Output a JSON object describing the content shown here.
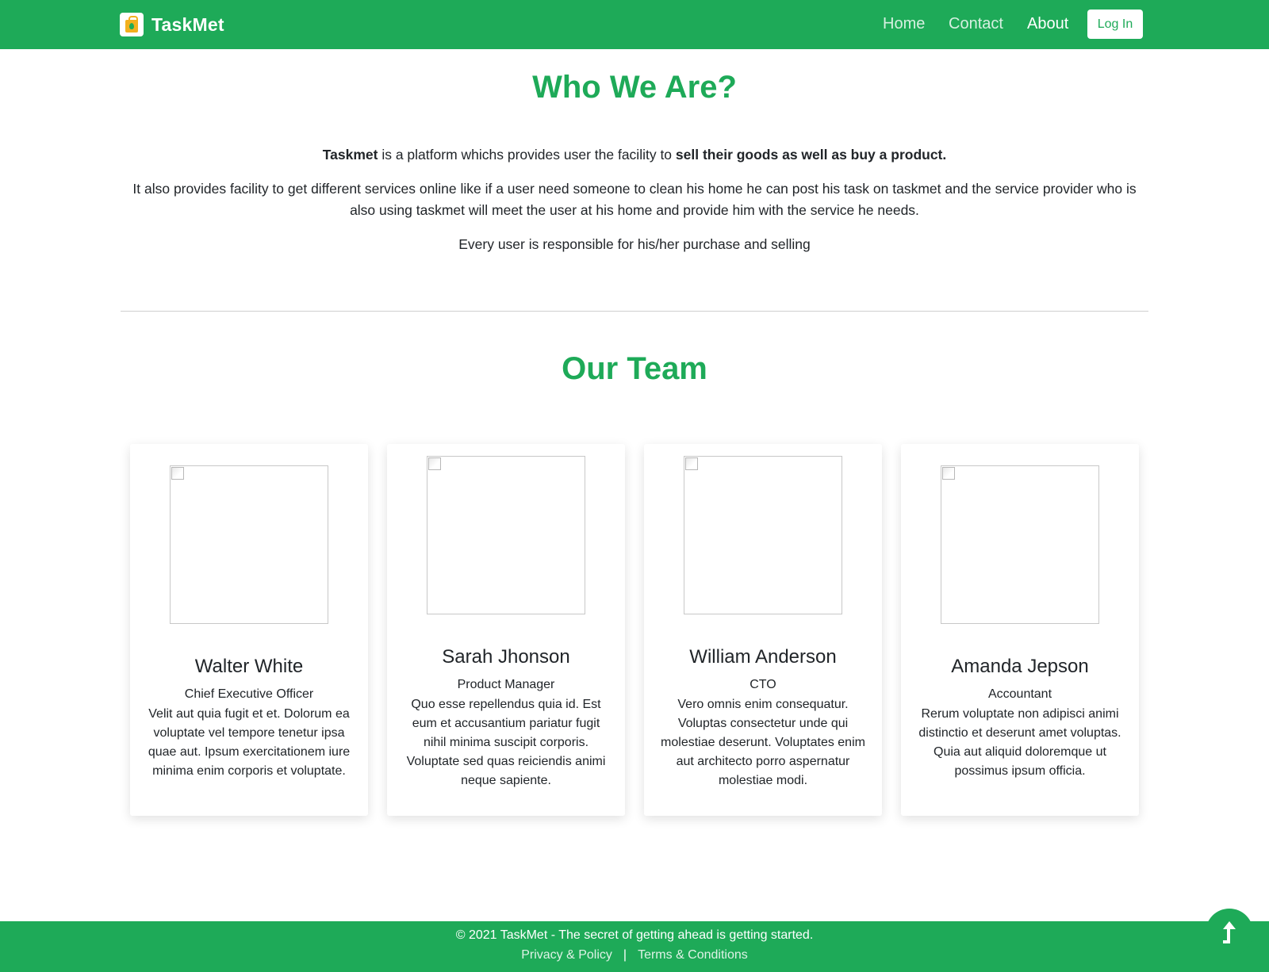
{
  "nav": {
    "brand": "TaskMet",
    "links": [
      "Home",
      "Contact",
      "About"
    ],
    "active": "About",
    "login_label": "Log In"
  },
  "about": {
    "title": "Who We Are?",
    "line1_bold": "Taskmet",
    "line1_text": " is a platform whichs provides user the facility to ",
    "line1_bold2": "sell their goods as well as buy a product.",
    "line2": "It also provides facility to get different services online like if a user need someone to clean his home he can post his task on taskmet and the service provider who is also using taskmet will meet the user at his home and provide him with the service he needs.",
    "line3": "Every user is responsible for his/her purchase and selling"
  },
  "team": {
    "title": "Our Team",
    "members": [
      {
        "name": "Walter White",
        "role": "Chief Executive Officer",
        "desc": "Velit aut quia fugit et et. Dolorum ea voluptate vel tempore tenetur ipsa quae aut. Ipsum exercitationem iure minima enim corporis et voluptate."
      },
      {
        "name": "Sarah Jhonson",
        "role": "Product Manager",
        "desc": "Quo esse repellendus quia id. Est eum et accusantium pariatur fugit nihil minima suscipit corporis. Voluptate sed quas reiciendis animi neque sapiente."
      },
      {
        "name": "William Anderson",
        "role": "CTO",
        "desc": "Vero omnis enim consequatur. Voluptas consectetur unde qui molestiae deserunt. Voluptates enim aut architecto porro aspernatur molestiae modi."
      },
      {
        "name": "Amanda Jepson",
        "role": "Accountant",
        "desc": "Rerum voluptate non adipisci animi distinctio et deserunt amet voluptas. Quia aut aliquid doloremque ut possimus ipsum officia."
      }
    ]
  },
  "footer": {
    "copyright": "© 2021 TaskMet - The secret of getting ahead is getting started.",
    "privacy": "Privacy & Policy",
    "separator": "|",
    "terms": "Terms & Conditions"
  },
  "icons": {
    "brand": "shopping-bag-icon",
    "back_to_top": "arrow-up-icon"
  },
  "colors": {
    "brand_green": "#1eaa58",
    "text": "#212529"
  }
}
